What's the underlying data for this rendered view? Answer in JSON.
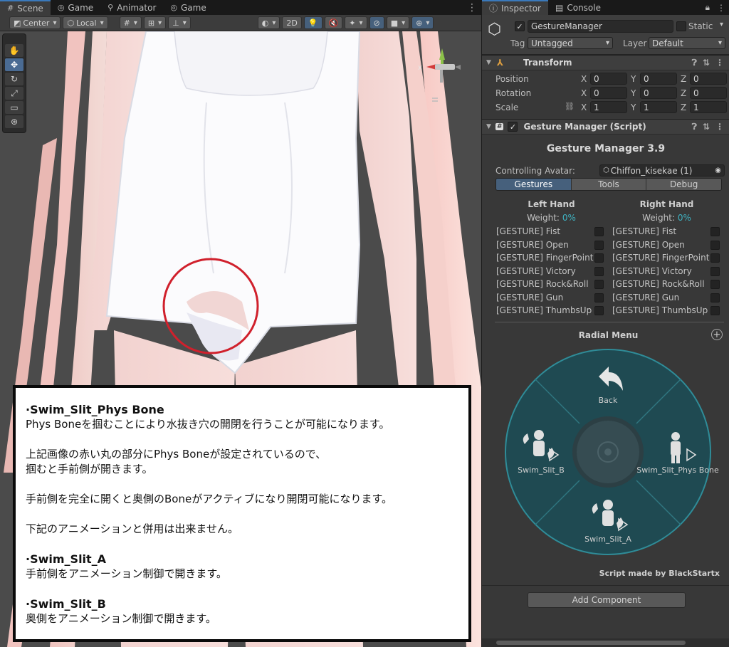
{
  "scene_tabs": [
    {
      "icon": "hash-icon",
      "label": "Scene"
    },
    {
      "icon": "gamepad-icon",
      "label": "Game"
    },
    {
      "icon": "animator-icon",
      "label": "Animator"
    },
    {
      "icon": "gamepad-icon",
      "label": "Game"
    }
  ],
  "scene_toolbar": {
    "pivot": "Center",
    "space": "Local",
    "mode_2d": "2D"
  },
  "note": {
    "title1": "·Swim_Slit_Phys Bone",
    "line1": "Phys Boneを掴むことにより水抜き穴の開閉を行うことが可能になります。",
    "line2": "上記画像の赤い丸の部分にPhys Boneが設定されているので、",
    "line3": "掴むと手前側が開きます。",
    "line4": "手前側を完全に開くと奥側のBoneがアクティブになり開閉可能になります。",
    "line5": "下記のアニメーションと併用は出来ません。",
    "title2": "·Swim_Slit_A",
    "line6": "手前側をアニメーション制御で開きます。",
    "title3": "·Swim_Slit_B",
    "line7": "奥側をアニメーション制御で開きます。"
  },
  "inspector": {
    "tabs": [
      {
        "icon": "info-icon",
        "label": "Inspector"
      },
      {
        "icon": "console-icon",
        "label": "Console"
      }
    ],
    "object_name": "GestureManager",
    "static_label": "Static",
    "tag_label": "Tag",
    "tag_value": "Untagged",
    "layer_label": "Layer",
    "layer_value": "Default",
    "transform": {
      "title": "Transform",
      "rows": [
        {
          "label": "Position",
          "x": "0",
          "y": "0",
          "z": "0"
        },
        {
          "label": "Rotation",
          "x": "0",
          "y": "0",
          "z": "0"
        },
        {
          "label": "Scale",
          "x": "1",
          "y": "1",
          "z": "1"
        }
      ],
      "axis_x": "X",
      "axis_y": "Y",
      "axis_z": "Z"
    },
    "gesture_manager": {
      "component_title": "Gesture Manager (Script)",
      "heading": "Gesture Manager 3.9",
      "avatar_label": "Controlling Avatar:",
      "avatar_value": "Chiffon_kisekae (1)",
      "tabs": [
        "Gestures",
        "Tools",
        "Debug"
      ],
      "left_hand": "Left Hand",
      "right_hand": "Right Hand",
      "weight_label": "Weight:",
      "weight_value": "0%",
      "gestures": [
        "[GESTURE] Fist",
        "[GESTURE] Open",
        "[GESTURE] FingerPoint",
        "[GESTURE] Victory",
        "[GESTURE] Rock&Roll",
        "[GESTURE] Gun",
        "[GESTURE] ThumbsUp"
      ],
      "radial_title": "Radial Menu",
      "radial_items": {
        "top": "Back",
        "left": "Swim_Slit_B",
        "right": "Swim_Slit_Phys Bone",
        "bottom": "Swim_Slit_A"
      },
      "credit": "Script made by BlackStartx"
    },
    "add_component": "Add Component"
  },
  "colors": {
    "accent": "#3a79bb",
    "radial_fill": "#1f4a52",
    "radial_ring": "#2f8c98",
    "highlight_red": "#d0202c"
  }
}
